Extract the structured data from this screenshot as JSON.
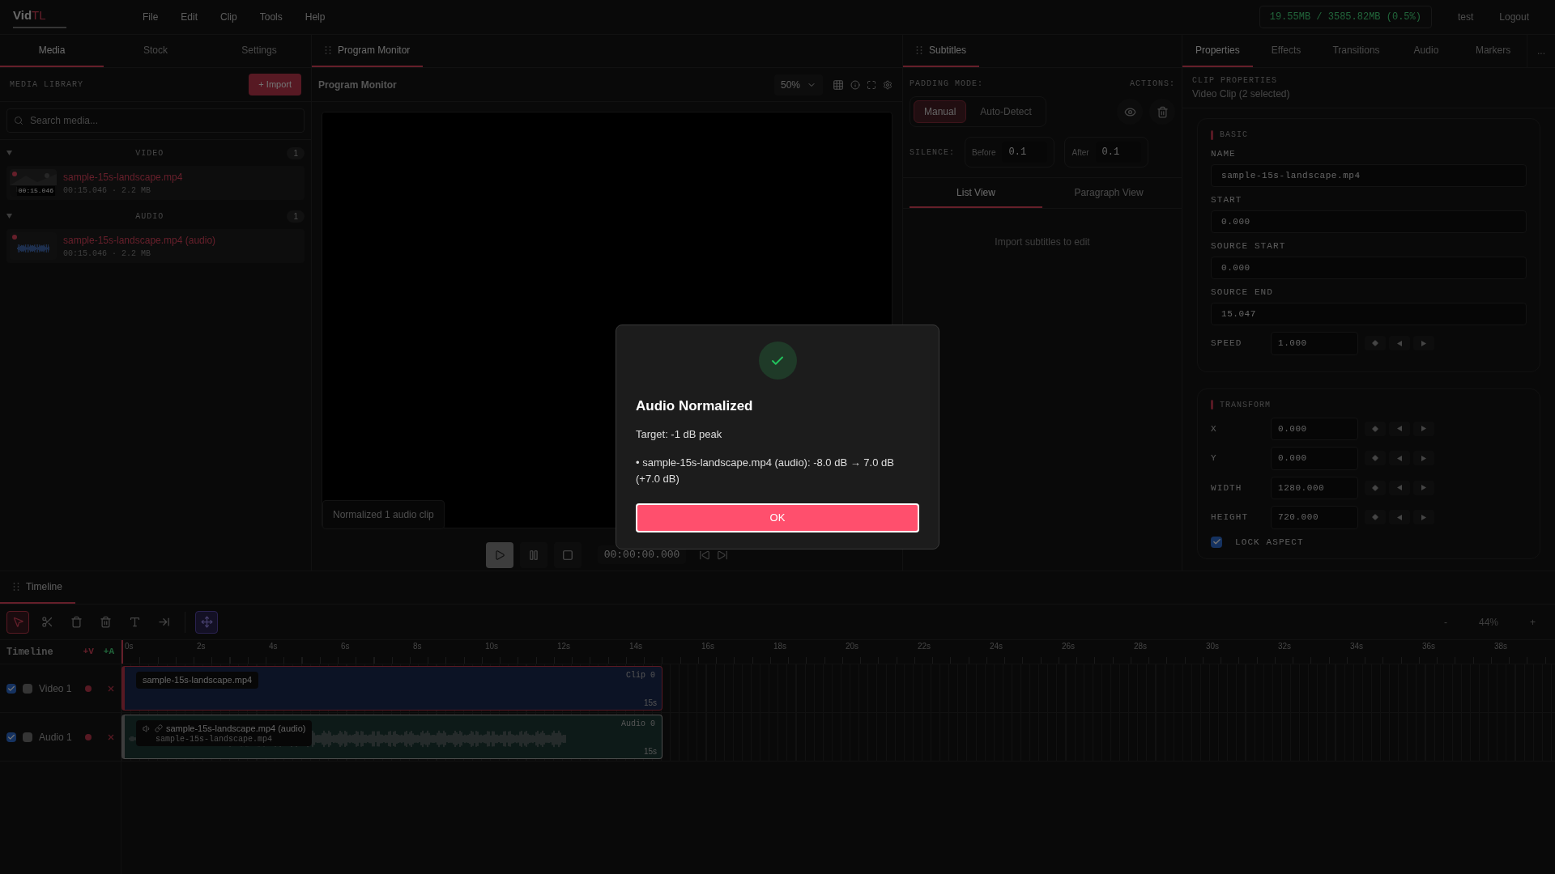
{
  "logo": {
    "main": "Vid",
    "accent": "TL"
  },
  "menu": [
    "File",
    "Edit",
    "Clip",
    "Tools",
    "Help"
  ],
  "memory": "19.55MB / 3585.82MB (0.5%)",
  "user": "test",
  "logout": "Logout",
  "left_tabs": [
    {
      "label": "Media",
      "selected": true
    },
    {
      "label": "Stock",
      "selected": false
    },
    {
      "label": "Settings",
      "selected": false
    }
  ],
  "media_library": {
    "title": "MEDIA LIBRARY",
    "import_button": "+ Import",
    "search": {
      "placeholder": "Search media..."
    },
    "groups": [
      {
        "kind": "video",
        "label": "VIDEO",
        "count": "1",
        "expanded": true,
        "items": [
          {
            "name": "sample-15s-landscape.mp4",
            "meta": "00:15.046 · 2.2 MB",
            "thumb_time": "00:15.046"
          }
        ]
      },
      {
        "kind": "audio",
        "label": "AUDIO",
        "count": "1",
        "expanded": true,
        "items": [
          {
            "name": "sample-15s-landscape.mp4 (audio)",
            "meta": "00:15.046 · 2.2 MB"
          }
        ]
      }
    ]
  },
  "monitor": {
    "tab": {
      "label": "Program Monitor",
      "selected": true
    },
    "title": "Program Monitor",
    "zoom": "50%",
    "toast": "Normalized 1 audio clip",
    "timecode": "00:00:00.000",
    "transport": [
      {
        "kind": "play",
        "selected": true
      },
      {
        "kind": "pause",
        "selected": false
      },
      {
        "kind": "stop",
        "selected": false
      }
    ]
  },
  "subtitles": {
    "tab": {
      "label": "Subtitles",
      "selected": true
    },
    "padding_label": "PADDING MODE:",
    "actions_label": "ACTIONS:",
    "modes": [
      {
        "label": "Manual",
        "selected": true
      },
      {
        "label": "Auto-Detect",
        "selected": false
      }
    ],
    "silence_label": "SILENCE:",
    "before": {
      "label": "Before",
      "value": "0.1"
    },
    "after": {
      "label": "After",
      "value": "0.1"
    },
    "views": [
      {
        "label": "List View",
        "selected": true
      },
      {
        "label": "Paragraph View",
        "selected": false
      }
    ],
    "empty": "Import subtitles to edit"
  },
  "right_tabs": [
    {
      "label": "Properties",
      "selected": true
    },
    {
      "label": "Effects",
      "selected": false
    },
    {
      "label": "Transitions",
      "selected": false
    },
    {
      "label": "Audio",
      "selected": false
    },
    {
      "label": "Markers",
      "selected": false
    }
  ],
  "more": "...",
  "properties": {
    "title": "CLIP PROPERTIES",
    "subtitle": "Video Clip (2 selected)",
    "sections": [
      {
        "title": "BASIC",
        "fields": [
          {
            "kind": "wide",
            "label": "NAME",
            "value": "sample-15s-landscape.mp4"
          },
          {
            "kind": "wide",
            "label": "START",
            "value": "0.000"
          },
          {
            "kind": "wide",
            "label": "SOURCE START",
            "value": "0.000"
          },
          {
            "kind": "wide",
            "label": "SOURCE END",
            "value": "15.047"
          },
          {
            "kind": "keyframe",
            "label": "SPEED",
            "value": "1.000"
          }
        ]
      },
      {
        "title": "TRANSFORM",
        "fields": [
          {
            "kind": "keyframe",
            "label": "X",
            "value": "0.000"
          },
          {
            "kind": "keyframe",
            "label": "Y",
            "value": "0.000"
          },
          {
            "kind": "keyframe",
            "label": "WIDTH",
            "value": "1280.000"
          },
          {
            "kind": "keyframe",
            "label": "HEIGHT",
            "value": "720.000"
          },
          {
            "kind": "checkbox",
            "label": "LOCK ASPECT",
            "checked": true
          }
        ]
      }
    ]
  },
  "timeline": {
    "tab": {
      "label": "Timeline",
      "selected": true
    },
    "tools": [
      {
        "kind": "select",
        "selected": true
      },
      {
        "kind": "cut",
        "selected": false
      },
      {
        "kind": "delete",
        "selected": false
      },
      {
        "kind": "ripple",
        "selected": false
      },
      {
        "kind": "text",
        "selected": false
      },
      {
        "kind": "trim",
        "selected": false
      },
      {
        "kind": "move",
        "selected": true
      }
    ],
    "zoom_out": "-",
    "zoom": "44%",
    "zoom_in": "+",
    "header": "Timeline",
    "add_video": "+V",
    "add_audio": "+A",
    "ticks": [
      "0s",
      "2s",
      "4s",
      "6s",
      "8s",
      "10s",
      "12s",
      "14s",
      "16s",
      "18s",
      "20s",
      "22s",
      "24s",
      "26s",
      "28s",
      "30s",
      "32s",
      "34s",
      "36s",
      "38s"
    ],
    "tracks": [
      {
        "kind": "video",
        "name": "Video 1",
        "visible": true,
        "second_checked": false,
        "clip": {
          "label": "sample-15s-landscape.mp4",
          "id": "Clip 0",
          "duration": "15s"
        }
      },
      {
        "kind": "audio",
        "name": "Audio 1",
        "visible": true,
        "second_checked": false,
        "clip": {
          "label": "sample-15s-landscape.mp4 (audio)",
          "source": "sample-15s-landscape.mp4",
          "id": "Audio 0",
          "duration": "15s"
        }
      }
    ]
  },
  "dialog": {
    "title": "Audio Normalized",
    "target": "Target: -1 dB peak",
    "detail": "• sample-15s-landscape.mp4 (audio): -8.0 dB → 7.0 dB (+7.0 dB)",
    "button": "OK"
  }
}
